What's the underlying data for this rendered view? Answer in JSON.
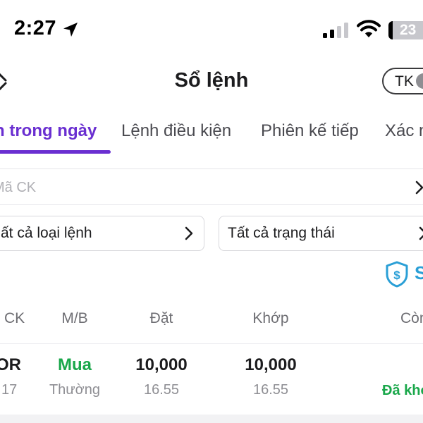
{
  "status_bar": {
    "time": "2:27",
    "battery": "23",
    "icons": [
      "location-arrow-icon",
      "cellular-signal-icon",
      "wifi-icon",
      "battery-icon"
    ]
  },
  "header": {
    "title": "Sổ lệnh",
    "account_label": "TK",
    "icons": [
      "back-arrow-icon"
    ]
  },
  "tabs": [
    {
      "label": "h trong ngày",
      "active": true
    },
    {
      "label": "Lệnh điều kiện",
      "active": false
    },
    {
      "label": "Phiên kế tiếp",
      "active": false
    },
    {
      "label": "Xác n",
      "active": false
    }
  ],
  "search": {
    "placeholder": "Mã CK",
    "value": ""
  },
  "filters": {
    "order_type": "ất cả loại lệnh",
    "status": "Tất cả trạng thái"
  },
  "shield": {
    "icon": "shield-dollar-icon",
    "label": "S"
  },
  "table": {
    "headers": {
      "symbol": "CK",
      "side": "M/B",
      "placed": "Đặt",
      "matched": "Khớp",
      "remaining": "Còn"
    },
    "rows": [
      {
        "symbol": "OR",
        "time": "17",
        "side": "Mua",
        "order_kind": "Thường",
        "placed_qty": "10,000",
        "placed_price": "16.55",
        "matched_qty": "10,000",
        "matched_price": "16.55",
        "status": "Đã khớ"
      }
    ]
  },
  "colors": {
    "accent": "#6a2fd1",
    "buy": "#19a74a",
    "shield": "#2a9fd6"
  }
}
